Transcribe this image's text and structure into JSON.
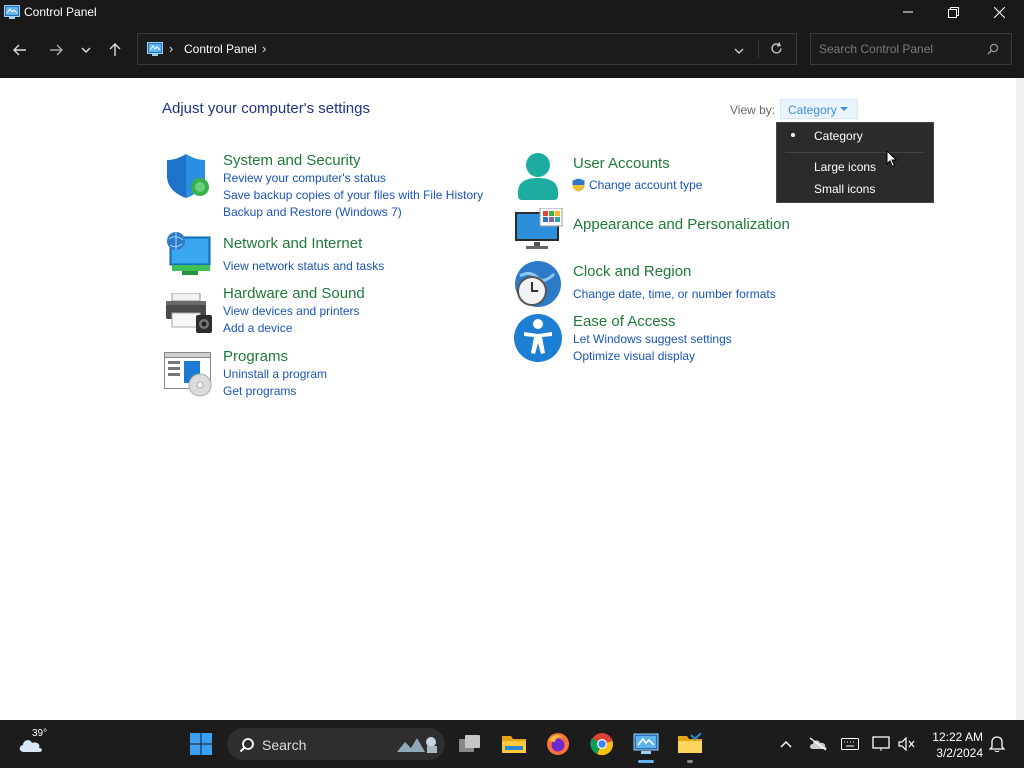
{
  "window": {
    "title": "Control Panel"
  },
  "address": {
    "crumb": "Control Panel"
  },
  "search": {
    "placeholder": "Search Control Panel"
  },
  "main": {
    "heading": "Adjust your computer's settings",
    "view_by_label": "View by:",
    "view_by_value": "Category"
  },
  "view_menu": {
    "items": [
      "Category",
      "Large icons",
      "Small icons"
    ],
    "selected": "Category"
  },
  "categories": {
    "system_security": {
      "title": "System and Security",
      "links": [
        "Review your computer's status",
        "Save backup copies of your files with File History",
        "Backup and Restore (Windows 7)"
      ]
    },
    "network": {
      "title": "Network and Internet",
      "links": [
        "View network status and tasks"
      ]
    },
    "hardware": {
      "title": "Hardware and Sound",
      "links": [
        "View devices and printers",
        "Add a device"
      ]
    },
    "programs": {
      "title": "Programs",
      "links": [
        "Uninstall a program",
        "Get programs"
      ]
    },
    "user_accounts": {
      "title": "User Accounts",
      "links": [
        "Change account type"
      ]
    },
    "appearance": {
      "title": "Appearance and Personalization",
      "links": []
    },
    "clock": {
      "title": "Clock and Region",
      "links": [
        "Change date, time, or number formats"
      ]
    },
    "ease": {
      "title": "Ease of Access",
      "links": [
        "Let Windows suggest settings",
        "Optimize visual display"
      ]
    }
  },
  "taskbar": {
    "weather_temp": "39°",
    "search_label": "Search",
    "time": "12:22 AM",
    "date": "3/2/2024"
  },
  "icons": [
    "control-panel-icon",
    "minimize-icon",
    "maximize-icon",
    "close-icon",
    "back-arrow-icon",
    "forward-arrow-icon",
    "recent-dropdown-icon",
    "up-arrow-icon",
    "refresh-icon",
    "search-icon",
    "shield-icon",
    "globe-monitor-icon",
    "printer-icon",
    "programs-icon",
    "user-icon",
    "uac-shield-icon",
    "appearance-icon",
    "clock-globe-icon",
    "ease-of-access-icon",
    "windows-start-icon",
    "task-view-icon",
    "file-explorer-icon",
    "firefox-icon",
    "chrome-icon",
    "cloud-icon",
    "notification-bell-icon"
  ],
  "colors": {
    "title_green": "#1f7a3a",
    "link_blue": "#1a55b8",
    "heading_blue": "#1e3287",
    "chrome_dark": "#191919"
  }
}
